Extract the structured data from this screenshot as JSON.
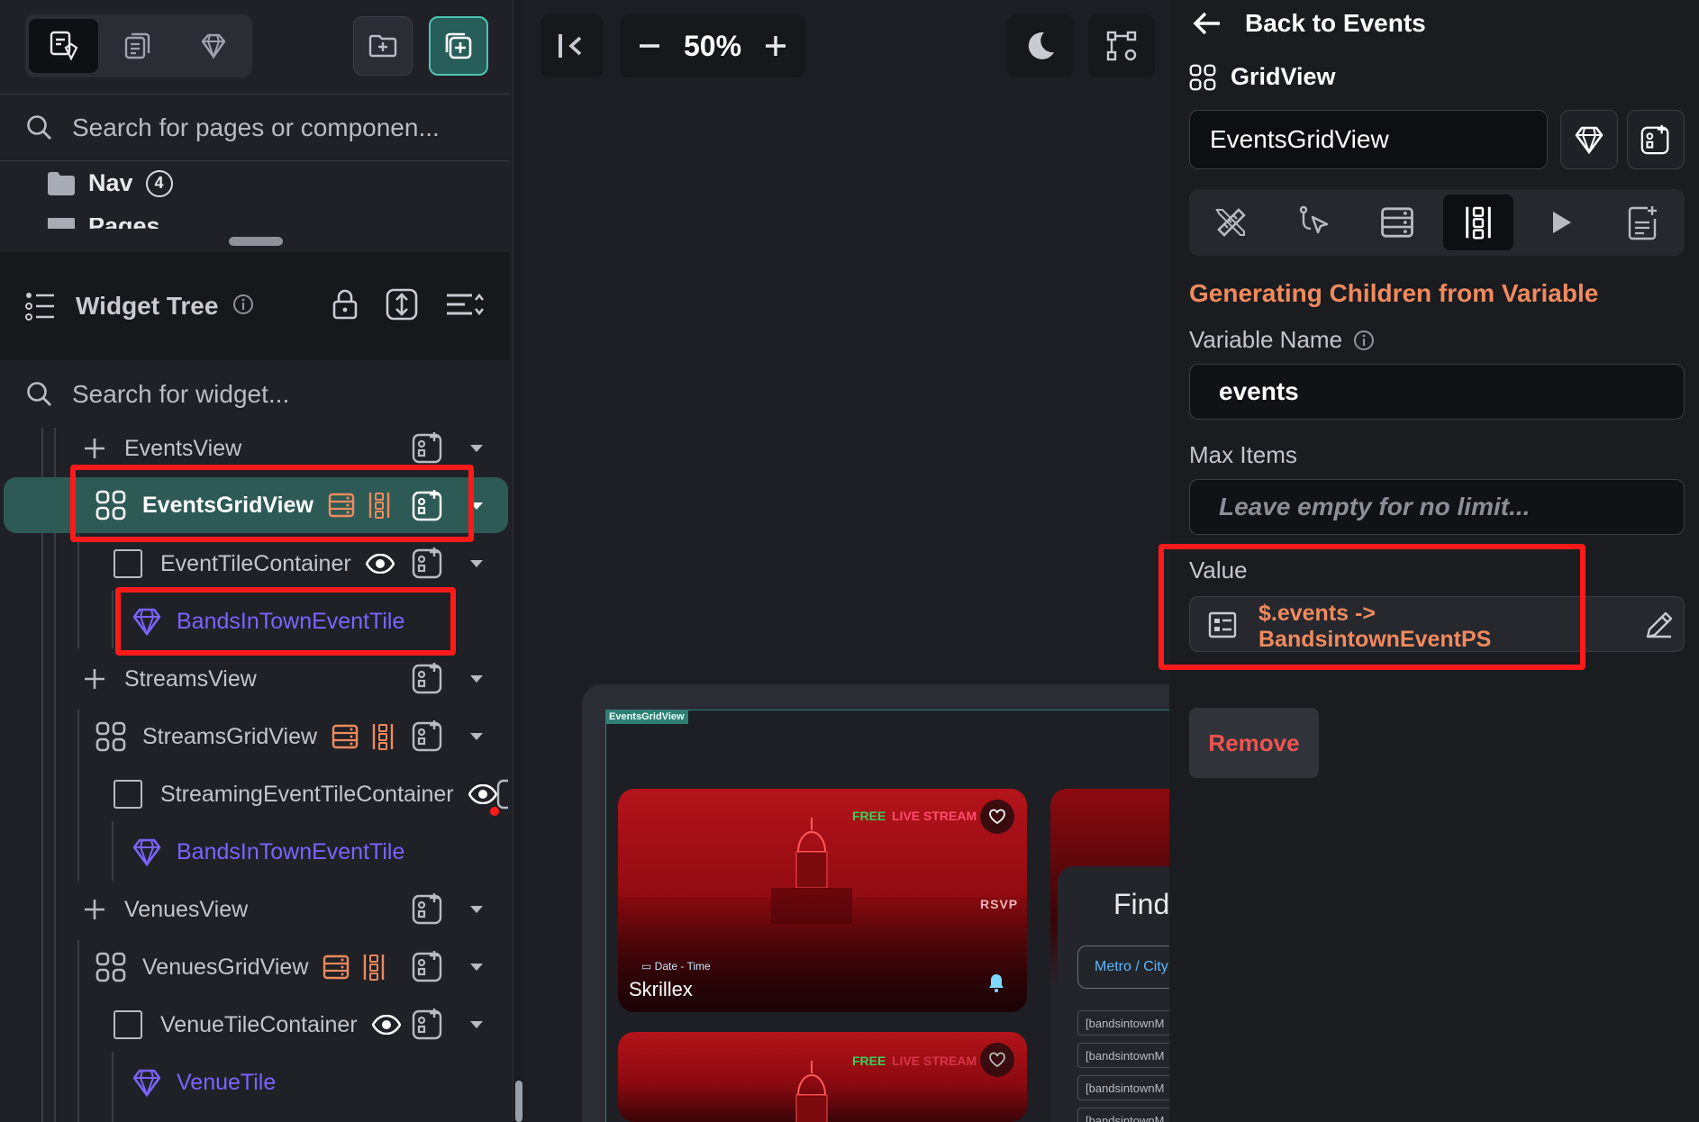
{
  "left_panel": {
    "search_placeholder": "Search for pages or componen...",
    "nav_folder": {
      "label": "Nav",
      "count": "4"
    },
    "partial_folder_label": "Pages",
    "widget_tree_title": "Widget Tree",
    "widget_search_placeholder": "Search for widget...",
    "tree": [
      {
        "label": "EventsView",
        "kind": "add"
      },
      {
        "label": "EventsGridView",
        "kind": "grid",
        "selected": true
      },
      {
        "label": "EventTileContainer",
        "kind": "container"
      },
      {
        "label": "BandsInTownEventTile",
        "kind": "component"
      },
      {
        "label": "StreamsView",
        "kind": "add"
      },
      {
        "label": "StreamsGridView",
        "kind": "grid"
      },
      {
        "label": "StreamingEventTileContainer",
        "kind": "container"
      },
      {
        "label": "BandsInTownEventTile",
        "kind": "component"
      },
      {
        "label": "VenuesView",
        "kind": "add"
      },
      {
        "label": "VenuesGridView",
        "kind": "grid"
      },
      {
        "label": "VenueTileContainer",
        "kind": "container"
      },
      {
        "label": "VenueTile",
        "kind": "component"
      }
    ]
  },
  "canvas": {
    "zoom": "50%",
    "gridview_tag": "EventsGridView",
    "card1": {
      "free": "FREE",
      "live": "LIVE STREAM",
      "rsvp": "RSVP",
      "date": "Date - Time",
      "name": "Skrillex"
    },
    "card2": {
      "free": "FREE",
      "live": "LIVE STREAM"
    },
    "side_card": {
      "title": "Find",
      "metro": "Metro / City",
      "rows": [
        "[bandsintownM",
        "[bandsintownM",
        "[bandsintownM",
        "[bandsintownM"
      ]
    }
  },
  "right_panel": {
    "back_label": "Back to Events",
    "widget_type": "GridView",
    "widget_name": "EventsGridView",
    "section_title": "Generating Children from Variable",
    "variable_name_label": "Variable Name",
    "variable_name_value": "events",
    "max_items_label": "Max Items",
    "max_items_placeholder": "Leave empty for no limit...",
    "value_label": "Value",
    "value_line1": "$.events ->",
    "value_line2": "BandsintownEventPS",
    "remove_label": "Remove"
  },
  "colors": {
    "accent_orange": "#f08a5d",
    "teal_selected": "#2e5a56",
    "component_purple": "#7c63ff",
    "highlight_red": "#ff1a1a",
    "remove_red": "#ef5350"
  }
}
